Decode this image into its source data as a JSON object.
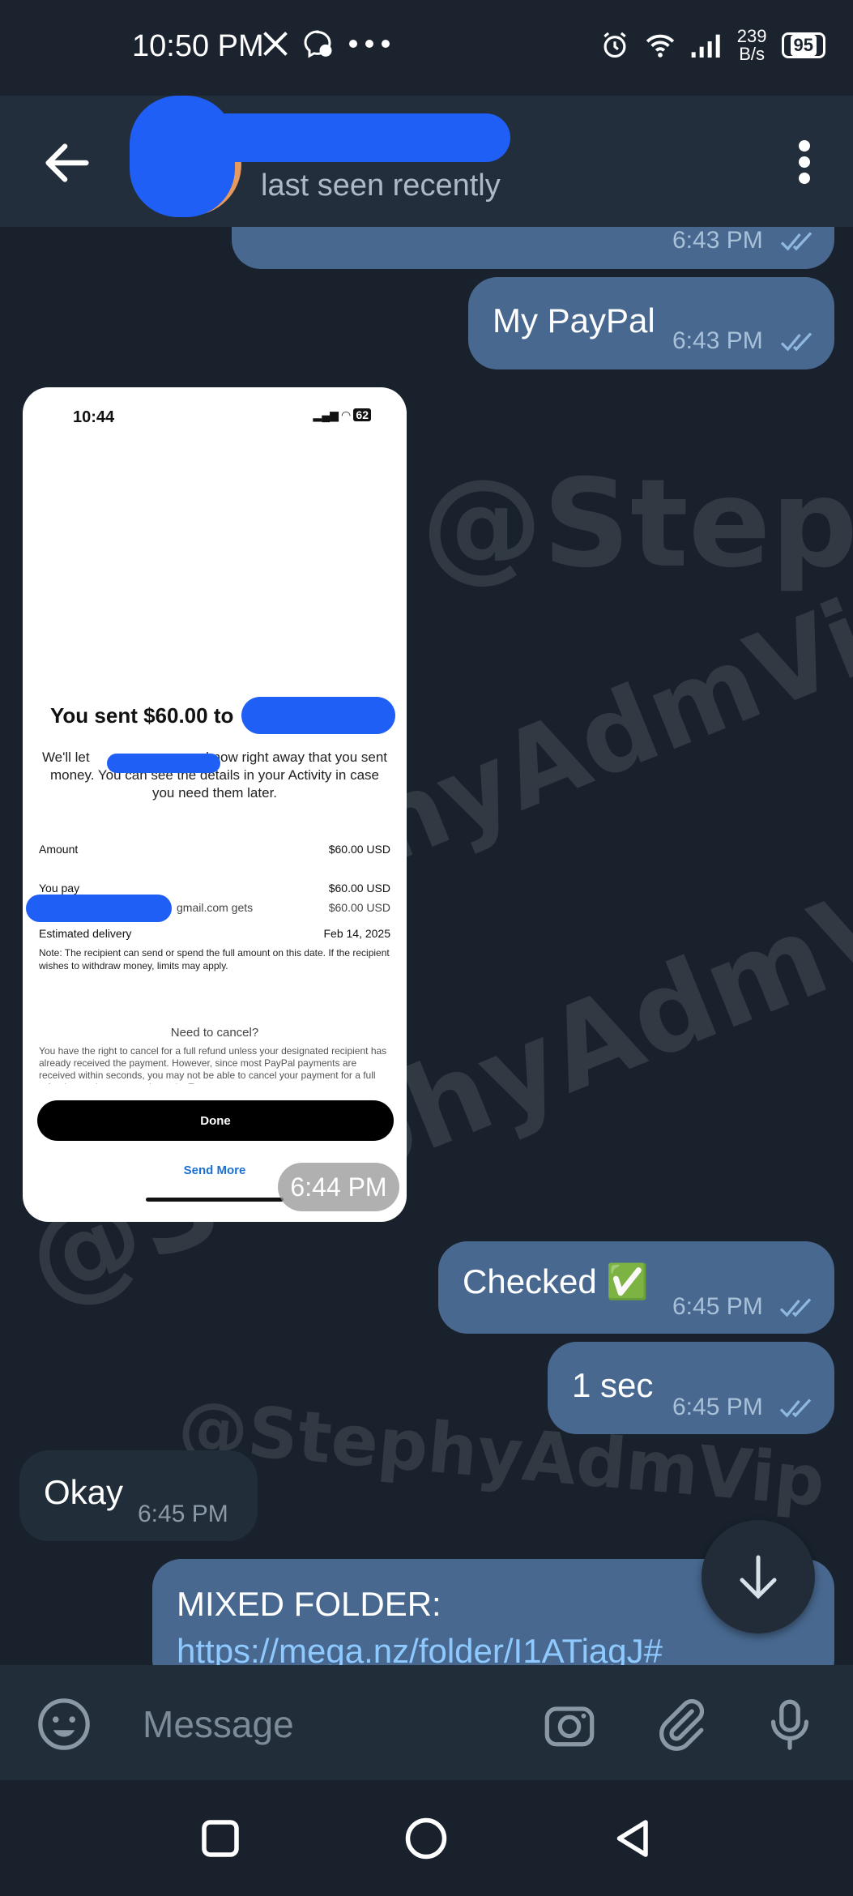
{
  "status_bar": {
    "time": "10:50 PM",
    "net_speed_value": "239",
    "net_speed_unit": "B/s",
    "battery": "95",
    "icons": [
      "x-icon",
      "messenger-icon",
      "more-dots-icon",
      "alarm-icon",
      "wifi-icon",
      "signal-icon",
      "battery-icon"
    ]
  },
  "header": {
    "status": "last seen recently",
    "icons": [
      "back-arrow-icon",
      "more-vert-icon"
    ]
  },
  "messages": [
    {
      "type": "out",
      "text": "",
      "time": "6:43 PM"
    },
    {
      "type": "out",
      "text": "My PayPal",
      "time": "6:43 PM"
    },
    {
      "type": "photo",
      "time": "6:44 PM"
    },
    {
      "type": "out",
      "text": "Checked ✅",
      "time": "6:45 PM"
    },
    {
      "type": "out",
      "text": "1 sec",
      "time": "6:45 PM"
    },
    {
      "type": "in",
      "text": "Okay",
      "time": "6:45 PM"
    },
    {
      "type": "out",
      "text": "MIXED FOLDER:",
      "link": "https://mega.nz/folder/I1ATiagJ#"
    }
  ],
  "photo": {
    "time": "10:44",
    "battery": "62",
    "title": "You sent $60.00 to",
    "body_prefix": "We'll let",
    "body": "know right away that you sent money. You can see the details in your Activity in case you need them later.",
    "amount_label": "Amount",
    "amount_value": "$60.00 USD",
    "you_pay_label": "You pay",
    "you_pay_value": "$60.00 USD",
    "gets_label": "gmail.com gets",
    "gets_value": "$60.00 USD",
    "delivery_label": "Estimated delivery",
    "delivery_value": "Feb 14, 2025",
    "note": "Note: The recipient can send or spend the full amount on this date. If the recipient wishes to withdraw money, limits may apply.",
    "cancel_title": "Need to cancel?",
    "cancel_body": "You have the right to cancel for a full refund unless your designated recipient has already received the payment. However, since most PayPal payments are received within seconds, you may not be able to cancel your payment for a full refund once the payment is made. To",
    "done": "Done",
    "send_more": "Send More"
  },
  "watermark": "@StephyAdmVip",
  "input": {
    "placeholder": "Message"
  },
  "colors": {
    "out_bubble": "#48688f",
    "in_bubble": "#222d3a",
    "background": "#18212c",
    "header": "#232e3c",
    "link": "#8ec9ff"
  }
}
